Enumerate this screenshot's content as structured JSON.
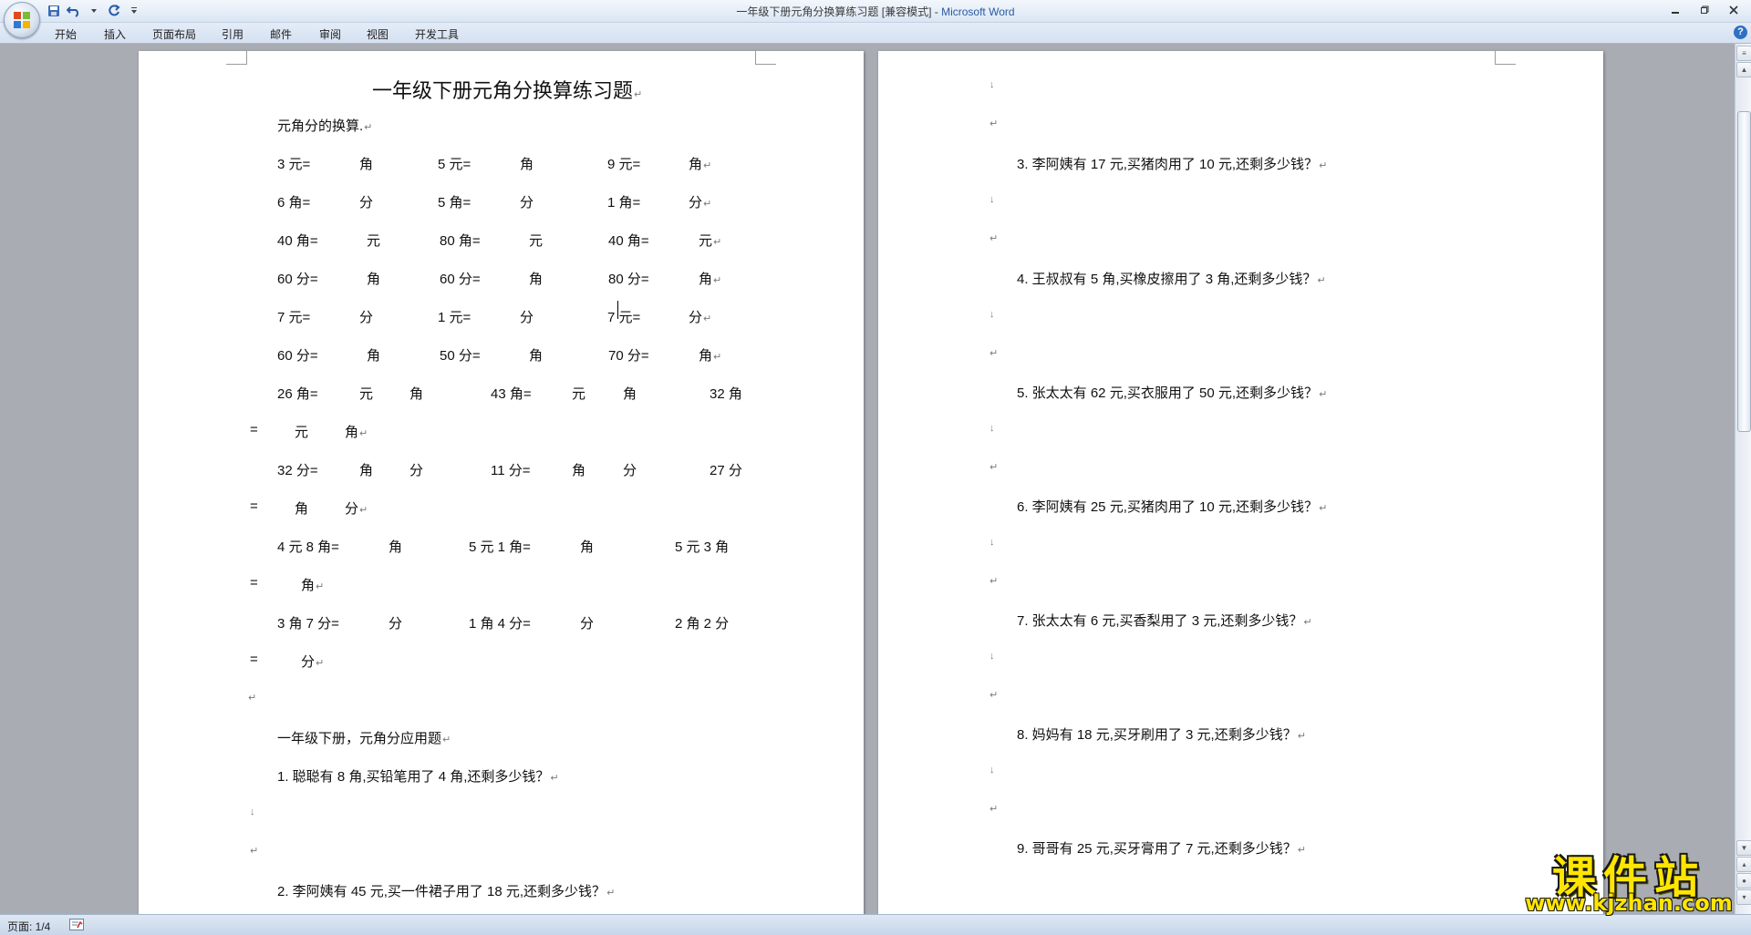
{
  "window": {
    "title_doc": "一年级下册元角分换算练习题 [兼容模式] - ",
    "title_app": "Microsoft Word"
  },
  "ribbon": {
    "tabs": [
      "开始",
      "插入",
      "页面布局",
      "引用",
      "邮件",
      "审阅",
      "视图",
      "开发工具"
    ]
  },
  "page1": {
    "title": "一年级下册元角分换算练习题",
    "section1": "元角分的换算.",
    "conv_rows": [
      {
        "c1": "3 元=",
        "u1": "角",
        "c2": "5 元=",
        "u2": "角",
        "c3": "9 元=",
        "u3": "角"
      },
      {
        "c1": "6 角=",
        "u1": "分",
        "c2": "5 角=",
        "u2": "分",
        "c3": "1 角=",
        "u3": "分"
      },
      {
        "c1": "40 角=",
        "u1": "元",
        "c2": "80 角=",
        "u2": "元",
        "c3": "40 角=",
        "u3": "元"
      },
      {
        "c1": "60 分=",
        "u1": "角",
        "c2": "60 分=",
        "u2": "角",
        "c3": "80 分=",
        "u3": "角"
      },
      {
        "c1": "7 元=",
        "u1": "分",
        "c2": "1 元=",
        "u2": "分",
        "c3": "7 元=",
        "u3": "分"
      },
      {
        "c1": "60 分=",
        "u1": "角",
        "c2": "50 分=",
        "u2": "角",
        "c3": "70 分=",
        "u3": "角"
      }
    ],
    "row7": {
      "a": "26 角=",
      "a1": "元",
      "a2": "角",
      "b": "43 角=",
      "b1": "元",
      "b2": "角",
      "c": "32 角"
    },
    "row7b": {
      "eq": "=",
      "u1": "元",
      "u2": "角"
    },
    "row8": {
      "a": "32 分=",
      "a1": "角",
      "a2": "分",
      "b": "11 分=",
      "b1": "角",
      "b2": "分",
      "c": "27 分"
    },
    "row8b": {
      "eq": "=",
      "u1": "角",
      "u2": "分"
    },
    "row9": {
      "a": "4 元 8 角=",
      "a1": "角",
      "b": "5 元 1 角=",
      "b1": "角",
      "c": "5 元 3 角"
    },
    "row9b": {
      "eq": "=",
      "u1": "角"
    },
    "row10": {
      "a": "3 角 7 分=",
      "a1": "分",
      "b": "1 角 4 分=",
      "b1": "分",
      "c": "2 角 2 分"
    },
    "row10b": {
      "eq": "=",
      "u1": "分"
    },
    "section2": "一年级下册，元角分应用题",
    "q1": "1. 聪聪有 8 角,买铅笔用了 4 角,还剩多少钱？",
    "q2": "2. 李阿姨有 45 元,买一件裙子用了 18 元,还剩多少钱？"
  },
  "page2": {
    "questions": [
      "3. 李阿姨有 17 元,买猪肉用了 10 元,还剩多少钱？",
      "4. 王叔叔有 5 角,买橡皮擦用了 3 角,还剩多少钱？",
      "5. 张太太有 62 元,买衣服用了 50 元,还剩多少钱？",
      "6. 李阿姨有 25 元,买猪肉用了 10 元,还剩多少钱？",
      "7. 张太太有 6 元,买香梨用了 3 元,还剩多少钱？",
      "8. 妈妈有 18 元,买牙刷用了 3 元,还剩多少钱？",
      "9. 哥哥有 25 元,买牙膏用了 7 元,还剩多少钱？"
    ]
  },
  "marks": {
    "paragraph": "↵",
    "line_break": "↓"
  },
  "status": {
    "page": "页面: 1/4"
  },
  "watermark": {
    "main": "课件站",
    "url": "www.kjzhan.com"
  },
  "colors": {
    "ribbon": "#d5e1f1",
    "workspace": "#a9acb3",
    "watermark": "#ffe600"
  }
}
